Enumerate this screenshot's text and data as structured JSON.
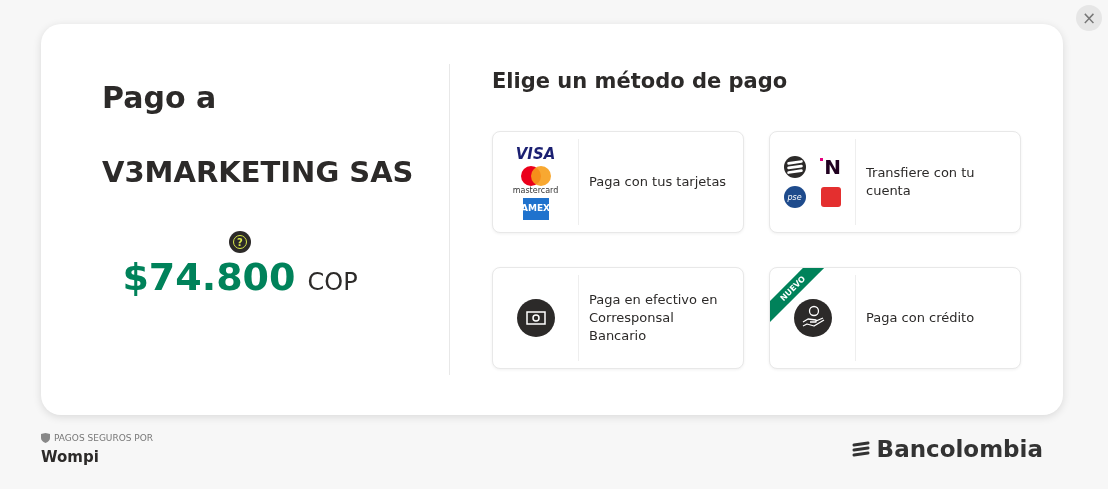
{
  "close_button": {
    "label": "×"
  },
  "merchant": {
    "prefix": "Pago a",
    "name": "V3MARKETING SAS"
  },
  "amount": {
    "value": "$74.800",
    "currency": "COP",
    "help_icon": {
      "label": "?"
    }
  },
  "methods_title": "Elige un método de pago",
  "methods": [
    {
      "label": "Paga con tus tarjetas",
      "kind": "cards",
      "logos": [
        {
          "kind": "visa",
          "text": "VISA"
        },
        {
          "kind": "mastercard",
          "text": "mastercard"
        },
        {
          "kind": "amex",
          "text": "AMEX"
        }
      ]
    },
    {
      "label": "Transfiere con tu cuenta",
      "kind": "transfer",
      "logos": [
        {
          "kind": "bancolombia"
        },
        {
          "kind": "nequi",
          "text": "N"
        },
        {
          "kind": "pse",
          "text": "pse"
        },
        {
          "kind": "daviplata"
        }
      ]
    },
    {
      "label": "Paga en efectivo en Corresponsal Bancario",
      "kind": "cash"
    },
    {
      "label": "Paga con crédito",
      "kind": "credit",
      "badge": "NUEVO"
    }
  ],
  "footer": {
    "secure_label": "PAGOS SEGUROS POR",
    "provider": "Wompi",
    "bank": "Bancolombia"
  }
}
